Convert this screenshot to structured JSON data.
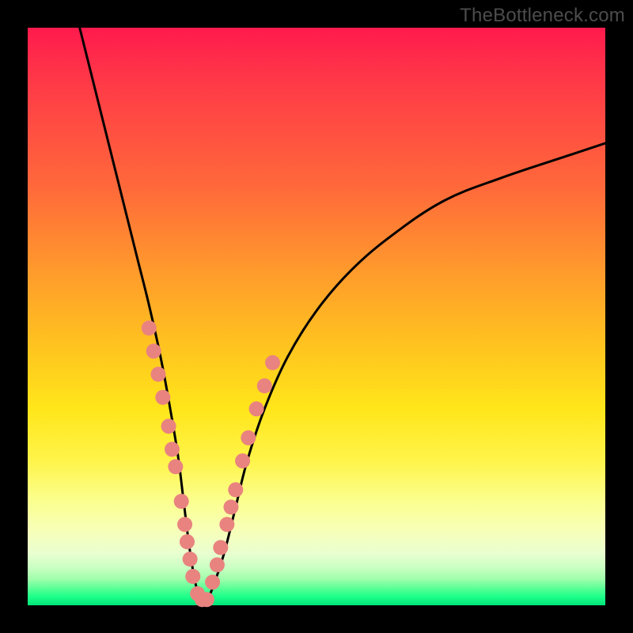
{
  "watermark": "TheBottleneck.com",
  "chart_data": {
    "type": "line",
    "title": "",
    "xlabel": "",
    "ylabel": "",
    "xlim": [
      0,
      100
    ],
    "ylim": [
      0,
      100
    ],
    "grid": false,
    "legend": false,
    "series": [
      {
        "name": "bottleneck-curve",
        "x": [
          9,
          11,
          13,
          15,
          17,
          19,
          21,
          23,
          24.5,
          26,
          27,
          28,
          29,
          30,
          31,
          32,
          34,
          36,
          38,
          41,
          45,
          50,
          56,
          63,
          72,
          82,
          94,
          100
        ],
        "y": [
          100,
          92,
          84,
          76,
          68,
          60,
          52,
          43,
          35,
          26,
          18,
          10,
          4,
          1,
          1,
          3,
          9,
          17,
          25,
          34,
          43,
          51,
          58,
          64,
          70,
          74,
          78,
          80
        ]
      }
    ],
    "markers": [
      {
        "name": "left-branch-dots",
        "x": [
          21.0,
          21.8,
          22.6,
          23.4,
          24.4,
          25.0,
          25.6,
          26.6,
          27.2,
          27.6,
          28.1,
          28.6,
          29.4,
          30.2,
          31.0
        ],
        "y": [
          48.0,
          44.0,
          40.0,
          36.0,
          31.0,
          27.0,
          24.0,
          18.0,
          14.0,
          11.0,
          8.0,
          5.0,
          2.0,
          1.0,
          1.0
        ]
      },
      {
        "name": "right-branch-dots",
        "x": [
          32.0,
          32.8,
          33.4,
          34.5,
          35.2,
          36.0,
          37.2,
          38.2,
          39.6,
          41.0,
          42.4
        ],
        "y": [
          4.0,
          7.0,
          10.0,
          14.0,
          17.0,
          20.0,
          25.0,
          29.0,
          34.0,
          38.0,
          42.0
        ]
      }
    ],
    "colors": {
      "curve": "#000000",
      "marker_fill": "#e98380",
      "marker_stroke": "#c95c59"
    }
  }
}
